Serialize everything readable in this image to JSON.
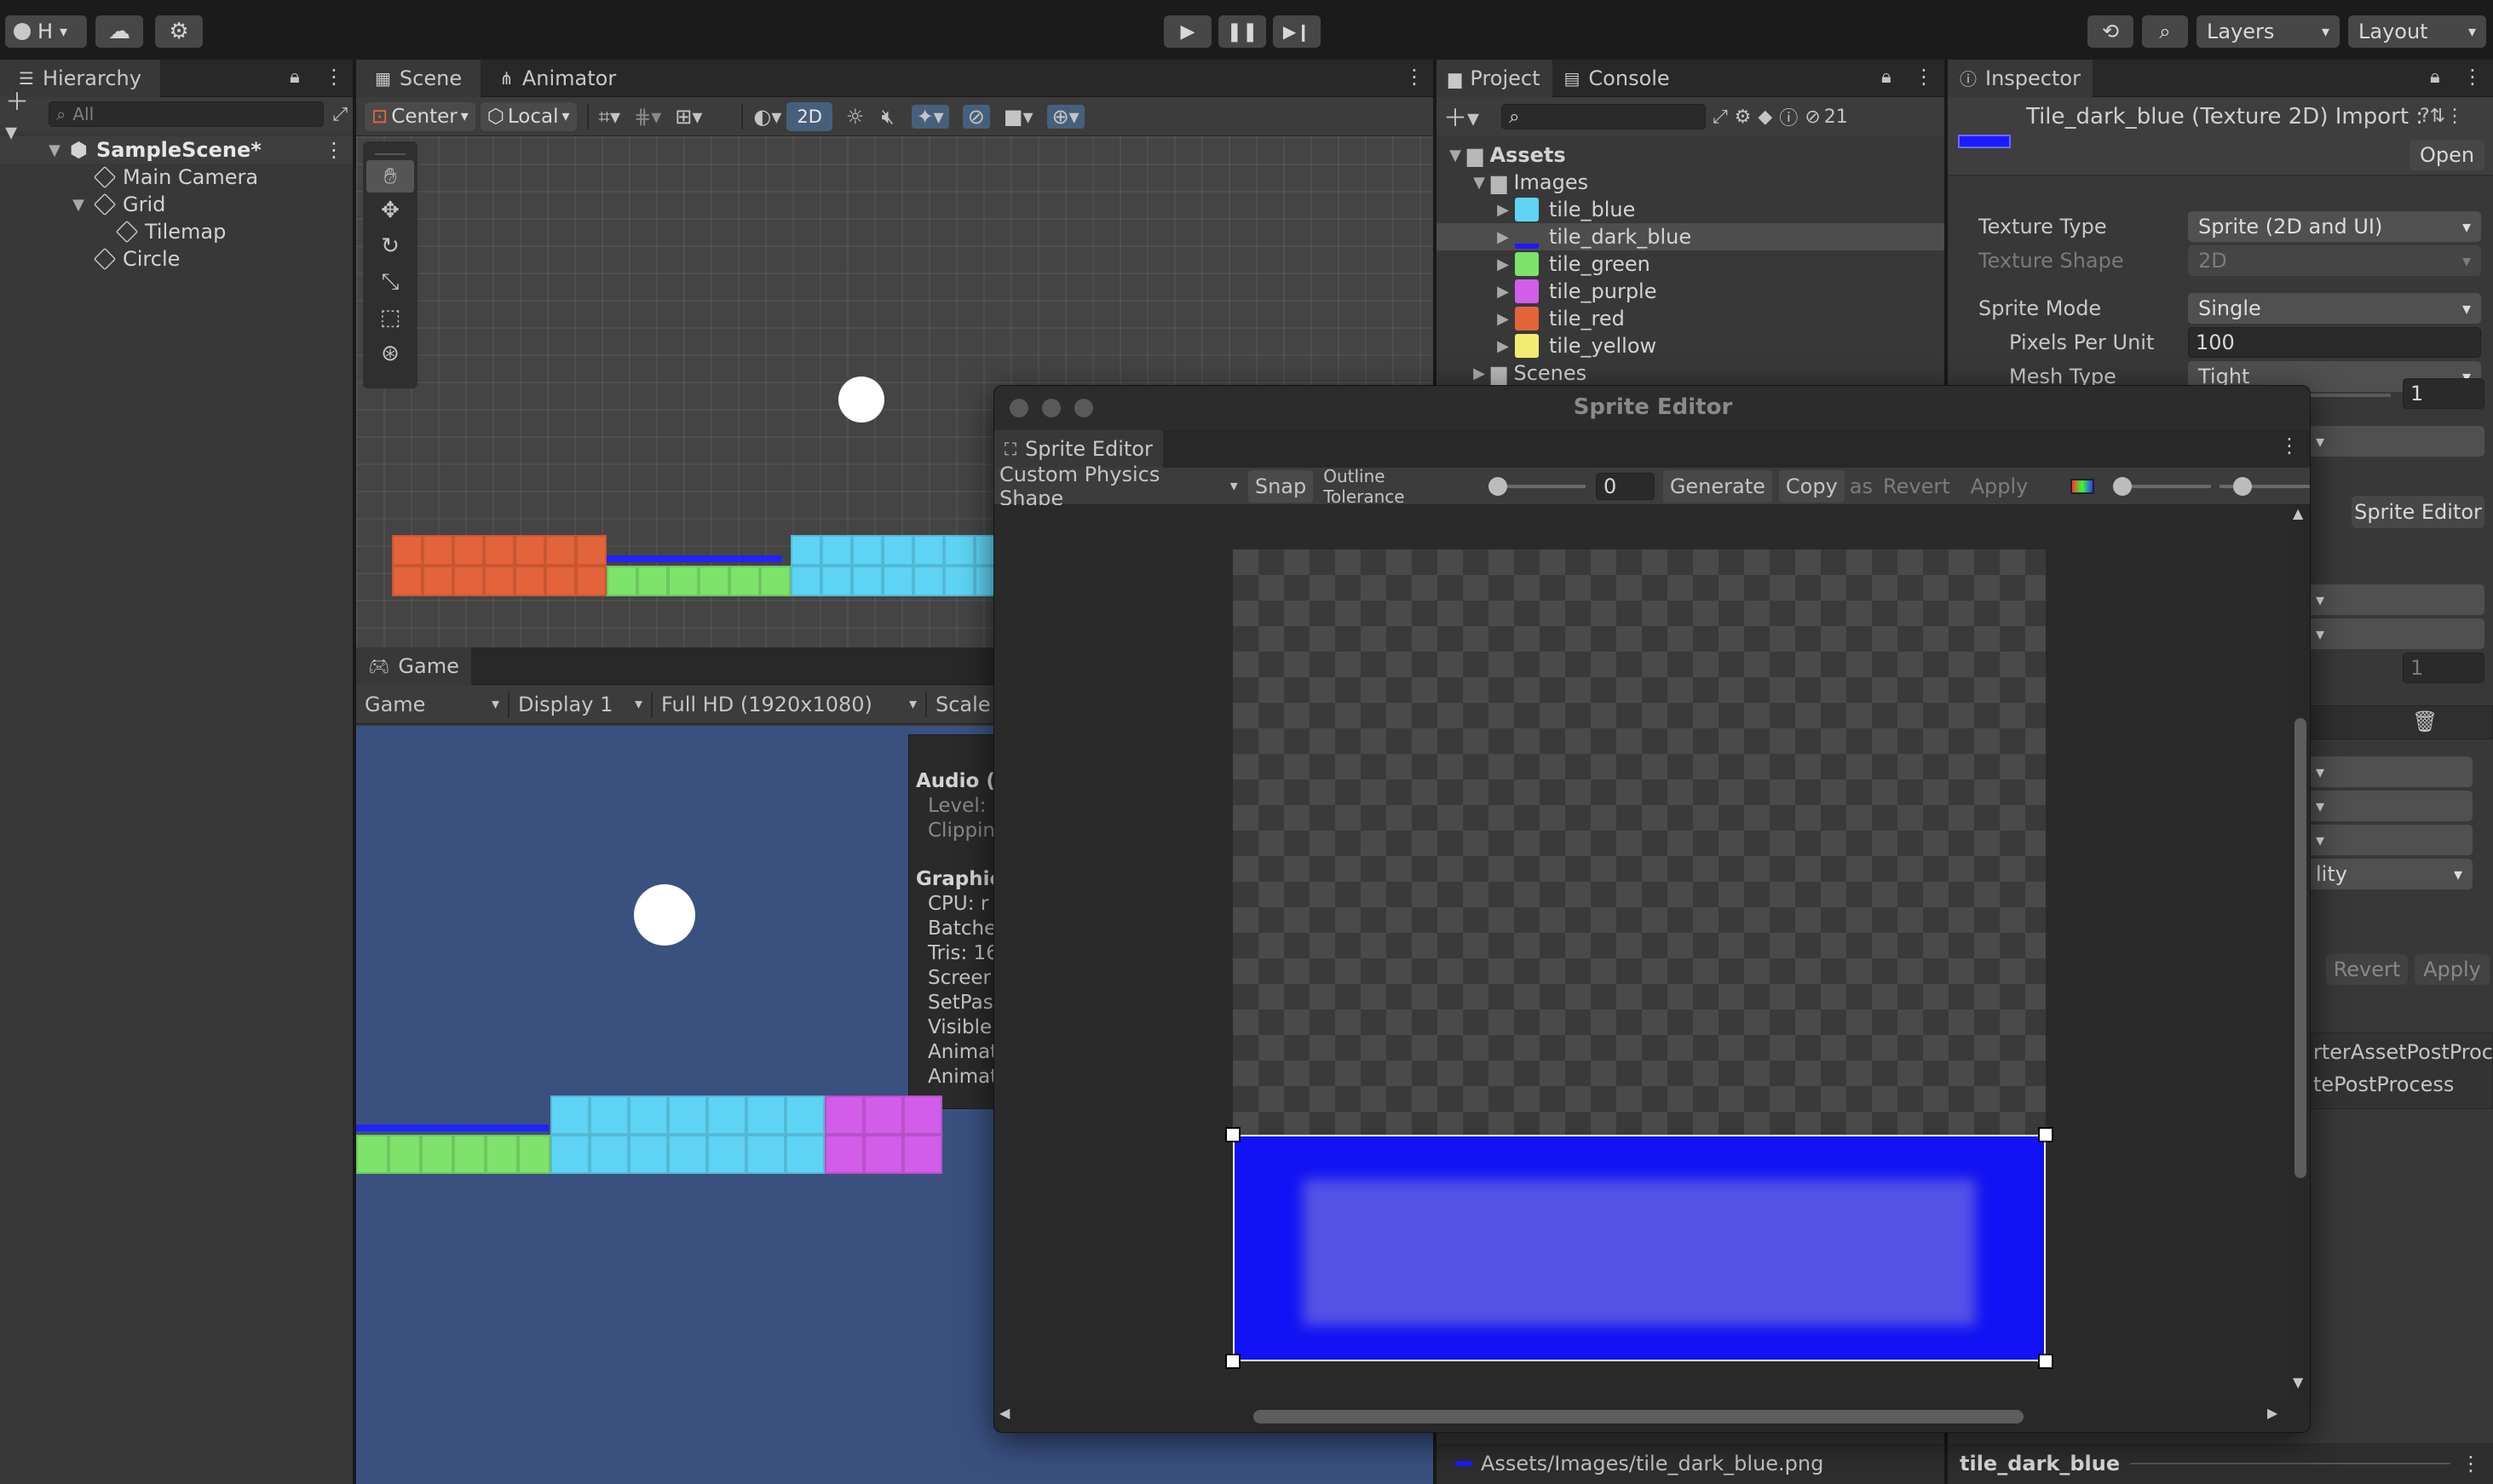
{
  "toolbar": {
    "account_label": "H",
    "layers_label": "Layers",
    "layout_label": "Layout"
  },
  "hierarchy": {
    "tab_label": "Hierarchy",
    "search_placeholder": "All",
    "scene_name": "SampleScene*",
    "items": {
      "main_camera": "Main Camera",
      "grid": "Grid",
      "tilemap": "Tilemap",
      "circle": "Circle"
    }
  },
  "scene_view": {
    "tabs": {
      "scene": "Scene",
      "animator": "Animator"
    },
    "pivot_label": "Center",
    "space_label": "Local",
    "mode_2d": "2D"
  },
  "game_view": {
    "tab_label": "Game",
    "mode_label": "Game",
    "display_label": "Display 1",
    "resolution_label": "Full HD (1920x1080)",
    "scale_label": "Scale",
    "stats": {
      "audio": "Audio (s",
      "level": "Level:",
      "clipping": "Clippin",
      "graphics": "Graphic",
      "cpu": "CPU: r",
      "batches": "Batche",
      "tris": "Tris: 16",
      "screen": "Screer",
      "setpass": "SetPas",
      "visible": "Visible",
      "anim1": "Animat",
      "anim2": "Animat"
    }
  },
  "project": {
    "tabs": {
      "project": "Project",
      "console": "Console"
    },
    "hidden_count": "21",
    "assets_label": "Assets",
    "images_label": "Images",
    "scenes_label": "Scenes",
    "items": [
      {
        "name": "tile_blue",
        "color": "#5fd3f3"
      },
      {
        "name": "tile_dark_blue",
        "color": "#1b1bff"
      },
      {
        "name": "tile_green",
        "color": "#7de36a"
      },
      {
        "name": "tile_purple",
        "color": "#d15de8"
      },
      {
        "name": "tile_red",
        "color": "#e3633a"
      },
      {
        "name": "tile_yellow",
        "color": "#f3ec73"
      }
    ],
    "footer_path": "Assets/Images/tile_dark_blue.png"
  },
  "inspector": {
    "tab_label": "Inspector",
    "title": "Tile_dark_blue (Texture 2D) Import :",
    "open_label": "Open",
    "fields": {
      "texture_type_label": "Texture Type",
      "texture_type_value": "Sprite (2D and UI)",
      "texture_shape_label": "Texture Shape",
      "texture_shape_value": "2D",
      "sprite_mode_label": "Sprite Mode",
      "sprite_mode_value": "Single",
      "ppu_label": "Pixels Per Unit",
      "ppu_value": "100",
      "mesh_type_label": "Mesh Type",
      "mesh_type_value": "Tight",
      "extrude_value": "1",
      "disabled_value": "1",
      "quality_fragment": "lity"
    },
    "sprite_editor_button": "Sprite Editor",
    "revert_label": "Revert",
    "apply_label": "Apply",
    "postprocess_1": "rterAssetPostProce",
    "postprocess_2": "tePostProcess",
    "footer_name": "tile_dark_blue"
  },
  "sprite_editor": {
    "window_title": "Sprite Editor",
    "tab_label": "Sprite Editor",
    "mode_label": "Custom Physics Shape",
    "snap_label": "Snap",
    "outline_label": "Outline Tolerance",
    "outline_value": "0",
    "generate_label": "Generate",
    "copy_label": "Copy",
    "paste_fragment": "as",
    "revert_label": "Revert",
    "apply_label": "Apply",
    "sprite_color": "#1212f4"
  }
}
